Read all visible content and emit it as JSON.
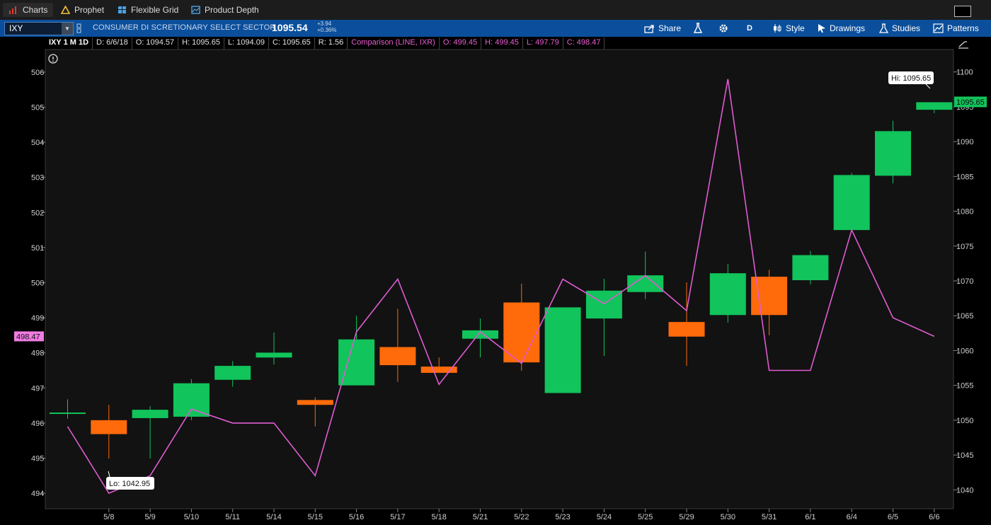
{
  "tabs": [
    {
      "label": "Charts",
      "icon": "bar-chart-icon"
    },
    {
      "label": "Prophet",
      "icon": "warning-triangle-icon"
    },
    {
      "label": "Flexible Grid",
      "icon": "grid-icon"
    },
    {
      "label": "Product Depth",
      "icon": "depth-icon"
    }
  ],
  "toolbar": {
    "symbol": "IXY",
    "description": "CONSUMER DI SCRETIONARY SELECT SECTOR",
    "last_price": "1095.54",
    "change": "+3.94",
    "change_pct": "+0.36%",
    "share_label": "Share",
    "period_label": "D",
    "style_label": "Style",
    "drawings_label": "Drawings",
    "studies_label": "Studies",
    "patterns_label": "Patterns"
  },
  "infobar": {
    "symbol_period": "IXY 1 M 1D",
    "date": "D: 6/6/18",
    "open": "O: 1094.57",
    "high": "H: 1095.65",
    "low": "L: 1094.09",
    "close": "C: 1095.65",
    "range": "R: 1.56",
    "comparison": "Comparison (LINE, IXR)",
    "cmp_open": "O: 499.45",
    "cmp_high": "H: 499.45",
    "cmp_low": "L: 497.79",
    "cmp_close": "C: 498.47"
  },
  "colors": {
    "up": "#11c45b",
    "down": "#ff6a0a",
    "comparison": "#df5bd1",
    "background": "#121212",
    "toolbar": "#0b4f9c",
    "price_tag": "#11c45b",
    "cmp_tag": "#f07ce3"
  },
  "chart_data": {
    "type": "candlestick",
    "title": "IXY 1 M 1D",
    "dates": [
      "5/8",
      "5/9",
      "5/10",
      "5/11",
      "5/14",
      "5/15",
      "5/16",
      "5/17",
      "5/18",
      "5/21",
      "5/22",
      "5/23",
      "5/24",
      "5/25",
      "5/29",
      "5/30",
      "5/31",
      "6/1",
      "6/4",
      "6/5",
      "6/6"
    ],
    "ohlc": [
      {
        "date": "5/7",
        "o": 1051.1,
        "h": 1053.0,
        "l": 1050.2,
        "c": 1051.1
      },
      {
        "date": "5/8",
        "o": 1050.0,
        "h": 1052.2,
        "l": 1044.5,
        "c": 1048.0
      },
      {
        "date": "5/9",
        "o": 1050.3,
        "h": 1052.0,
        "l": 1044.5,
        "c": 1051.5
      },
      {
        "date": "5/10",
        "o": 1050.5,
        "h": 1055.9,
        "l": 1050.0,
        "c": 1055.3
      },
      {
        "date": "5/11",
        "o": 1055.8,
        "h": 1058.5,
        "l": 1054.8,
        "c": 1057.8
      },
      {
        "date": "5/14",
        "o": 1059.0,
        "h": 1062.6,
        "l": 1058.0,
        "c": 1059.7
      },
      {
        "date": "5/15",
        "o": 1052.9,
        "h": 1053.3,
        "l": 1049.1,
        "c": 1052.2
      },
      {
        "date": "5/16",
        "o": 1055.0,
        "h": 1065.0,
        "l": 1055.0,
        "c": 1061.6
      },
      {
        "date": "5/17",
        "o": 1060.5,
        "h": 1066.0,
        "l": 1055.5,
        "c": 1057.9
      },
      {
        "date": "5/18",
        "o": 1057.7,
        "h": 1059.0,
        "l": 1056.8,
        "c": 1056.8
      },
      {
        "date": "5/21",
        "o": 1061.7,
        "h": 1064.6,
        "l": 1059.0,
        "c": 1062.9
      },
      {
        "date": "5/22",
        "o": 1066.9,
        "h": 1069.6,
        "l": 1057.1,
        "c": 1058.3
      },
      {
        "date": "5/23",
        "o": 1053.9,
        "h": 1066.2,
        "l": 1053.9,
        "c": 1066.2
      },
      {
        "date": "5/24",
        "o": 1064.6,
        "h": 1070.3,
        "l": 1059.2,
        "c": 1068.6
      },
      {
        "date": "5/25",
        "o": 1068.4,
        "h": 1074.2,
        "l": 1067.4,
        "c": 1070.8
      },
      {
        "date": "5/29",
        "o": 1064.1,
        "h": 1069.8,
        "l": 1057.8,
        "c": 1062.0
      },
      {
        "date": "5/30",
        "o": 1065.1,
        "h": 1072.4,
        "l": 1064.0,
        "c": 1071.1
      },
      {
        "date": "5/31",
        "o": 1070.6,
        "h": 1071.6,
        "l": 1062.2,
        "c": 1065.1
      },
      {
        "date": "6/1",
        "o": 1070.1,
        "h": 1074.3,
        "l": 1069.5,
        "c": 1073.7
      },
      {
        "date": "6/4",
        "o": 1077.3,
        "h": 1085.5,
        "l": 1077.3,
        "c": 1085.2
      },
      {
        "date": "6/5",
        "o": 1085.1,
        "h": 1093.0,
        "l": 1084.0,
        "c": 1091.5
      },
      {
        "date": "6/6",
        "o": 1094.57,
        "h": 1095.65,
        "l": 1094.09,
        "c": 1095.65
      }
    ],
    "comparison_series": {
      "name": "Comparison (LINE, IXR)",
      "values": [
        495.9,
        494.0,
        494.5,
        496.4,
        496.0,
        496.0,
        494.5,
        498.6,
        500.1,
        497.1,
        498.6,
        497.7,
        500.1,
        499.4,
        500.2,
        499.2,
        505.8,
        497.5,
        497.5,
        501.5,
        499.0,
        498.47
      ]
    },
    "right_axis": {
      "range": [
        1038,
        1102
      ],
      "ticks": [
        "1040",
        "1045",
        "1050",
        "1055",
        "1060",
        "1065",
        "1070",
        "1075",
        "1080",
        "1085",
        "1090",
        "1095",
        "1100"
      ]
    },
    "left_axis": {
      "range": [
        493.7,
        506.4
      ],
      "ticks": [
        "494",
        "495",
        "496",
        "497",
        "498",
        "499",
        "500",
        "501",
        "502",
        "503",
        "504",
        "505",
        "506"
      ]
    },
    "annotations": {
      "high": "Hi: 1095.65",
      "low": "Lo: 1042.95"
    },
    "last_price_tag": "1095.65",
    "comparison_tag": "498.47"
  }
}
